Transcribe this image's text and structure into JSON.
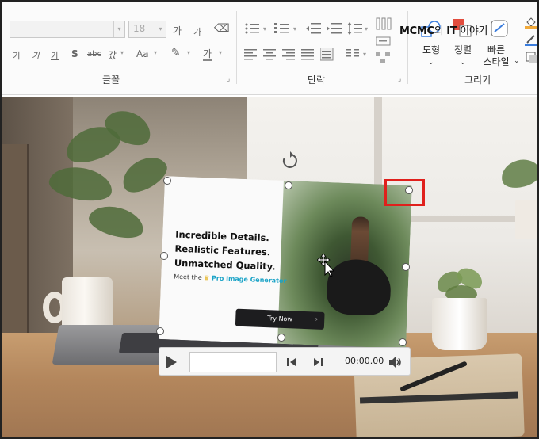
{
  "ribbon": {
    "font_size": "18",
    "groups": {
      "font": "글꼴",
      "paragraph": "단락",
      "drawing": "그리기"
    },
    "font_buttons": {
      "grow": "가",
      "shrink": "가",
      "bold": "가",
      "italic": "가",
      "underline": "가",
      "shadow": "S",
      "strike": "abc",
      "spacing": "갔",
      "case": "Aa",
      "color": "가"
    },
    "drawing": {
      "shapes": "도형",
      "arrange": "정렬",
      "quick_styles_line1": "빠른",
      "quick_styles_line2": "스타일"
    }
  },
  "watermark": {
    "part1": "MCMC",
    "part2": "의 ",
    "part3": "IT",
    "part4": " 이야기"
  },
  "video": {
    "headline": [
      "Incredible Details.",
      "Realistic Features.",
      "Unmatched Quality."
    ],
    "meet_prefix": "Meet the",
    "crown": "♛",
    "brand": "Pro Image Generator",
    "cta": "Try Now",
    "cta_chevron": "›"
  },
  "media_controls": {
    "time": "00:00.00"
  },
  "colors": {
    "highlight": "#e0201c",
    "brand": "#1aa3c7"
  }
}
